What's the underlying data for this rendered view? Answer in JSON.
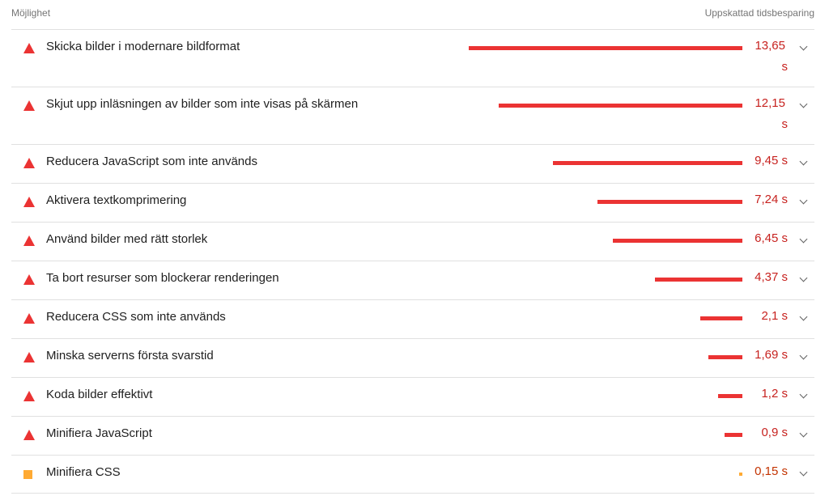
{
  "header": {
    "left": "Möjlighet",
    "right": "Uppskattad tidsbesparing"
  },
  "colors": {
    "fail": "#eb3333",
    "average": "#ffaa33",
    "fail_text": "#c7221f"
  },
  "icons": {
    "fail": "warning-triangle-icon",
    "average": "orange-square-icon",
    "expand": "chevron-down-icon"
  },
  "opportunities": [
    {
      "label": "Skicka bilder i modernare bildformat",
      "value": "13,65",
      "unit": "s",
      "seconds": 13.65,
      "severity": "fail"
    },
    {
      "label": "Skjut upp inläsningen av bilder som inte visas på skärmen",
      "value": "12,15",
      "unit": "s",
      "seconds": 12.15,
      "severity": "fail"
    },
    {
      "label": "Reducera JavaScript som inte används",
      "value": "9,45 s",
      "seconds": 9.45,
      "severity": "fail"
    },
    {
      "label": "Aktivera textkomprimering",
      "value": "7,24 s",
      "seconds": 7.24,
      "severity": "fail"
    },
    {
      "label": "Använd bilder med rätt storlek",
      "value": "6,45 s",
      "seconds": 6.45,
      "severity": "fail"
    },
    {
      "label": "Ta bort resurser som blockerar renderingen",
      "value": "4,37 s",
      "seconds": 4.37,
      "severity": "fail"
    },
    {
      "label": "Reducera CSS som inte används",
      "value": "2,1 s",
      "seconds": 2.1,
      "severity": "fail"
    },
    {
      "label": "Minska serverns första svarstid",
      "value": "1,69 s",
      "seconds": 1.69,
      "severity": "fail"
    },
    {
      "label": "Koda bilder effektivt",
      "value": "1,2 s",
      "seconds": 1.2,
      "severity": "fail"
    },
    {
      "label": "Minifiera JavaScript",
      "value": "0,9 s",
      "seconds": 0.9,
      "severity": "fail"
    },
    {
      "label": "Minifiera CSS",
      "value": "0,15 s",
      "seconds": 0.15,
      "severity": "average"
    }
  ]
}
